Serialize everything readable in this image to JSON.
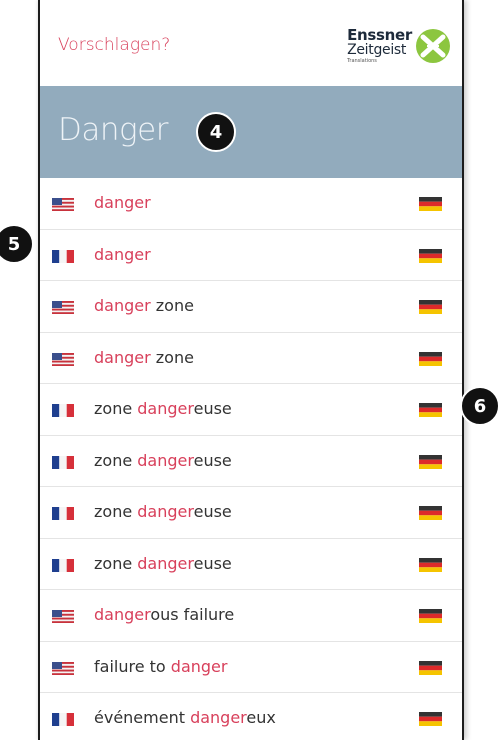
{
  "topbar": {
    "suggest_label": "Vorschlagen?"
  },
  "logo": {
    "line1": "Enssner",
    "line2": "Zeitgeist",
    "line3": "Translations"
  },
  "header": {
    "title": "Danger"
  },
  "badges": [
    "4",
    "5",
    "6"
  ],
  "colors": {
    "accent": "#d8405b",
    "header_bg": "#92abbd"
  },
  "rows": [
    {
      "flag": "us",
      "pre": "",
      "hl": "danger",
      "post": ""
    },
    {
      "flag": "fr",
      "pre": "",
      "hl": "danger",
      "post": ""
    },
    {
      "flag": "us",
      "pre": "",
      "hl": "danger",
      "post": " zone"
    },
    {
      "flag": "us",
      "pre": "",
      "hl": "danger",
      "post": " zone"
    },
    {
      "flag": "fr",
      "pre": "zone ",
      "hl": "danger",
      "post": "euse"
    },
    {
      "flag": "fr",
      "pre": "zone ",
      "hl": "danger",
      "post": "euse"
    },
    {
      "flag": "fr",
      "pre": "zone ",
      "hl": "danger",
      "post": "euse"
    },
    {
      "flag": "fr",
      "pre": "zone ",
      "hl": "danger",
      "post": "euse"
    },
    {
      "flag": "us",
      "pre": "",
      "hl": "danger",
      "post": "ous failure"
    },
    {
      "flag": "us",
      "pre": "failure to ",
      "hl": "danger",
      "post": ""
    },
    {
      "flag": "fr",
      "pre": "événement ",
      "hl": "danger",
      "post": "eux"
    }
  ]
}
